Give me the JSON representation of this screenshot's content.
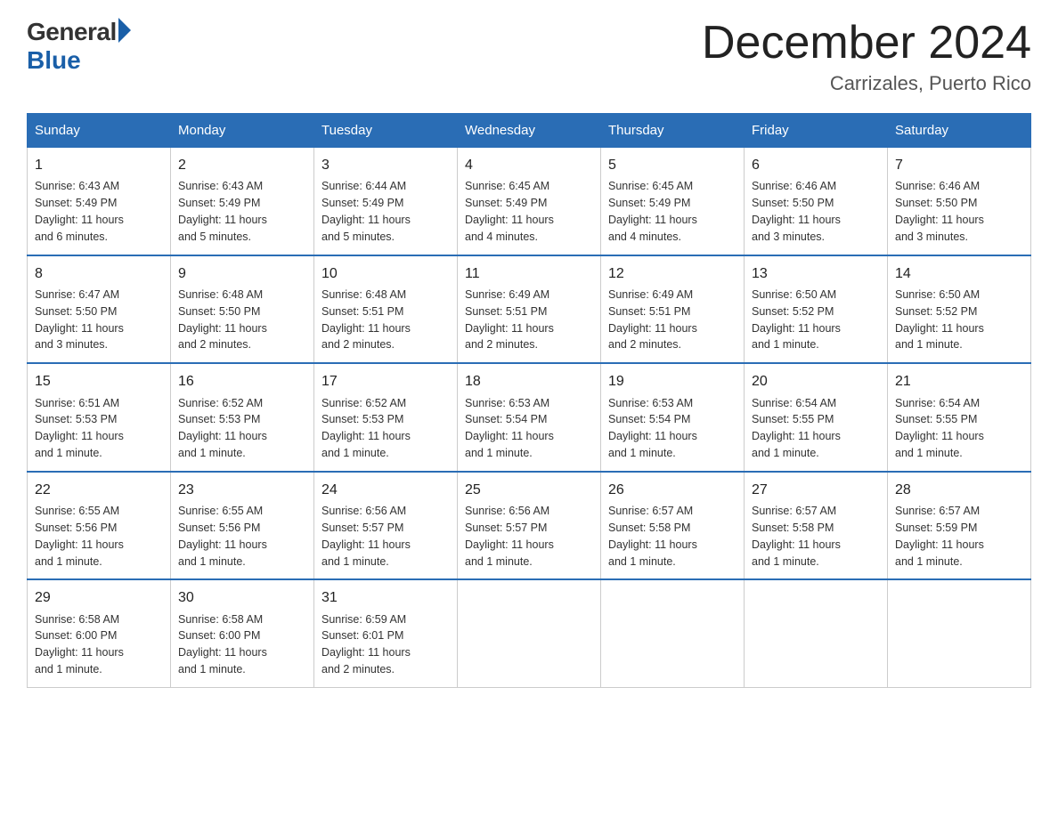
{
  "logo": {
    "general": "General",
    "blue": "Blue"
  },
  "title": "December 2024",
  "location": "Carrizales, Puerto Rico",
  "days_of_week": [
    "Sunday",
    "Monday",
    "Tuesday",
    "Wednesday",
    "Thursday",
    "Friday",
    "Saturday"
  ],
  "weeks": [
    [
      {
        "day": "1",
        "sunrise": "6:43 AM",
        "sunset": "5:49 PM",
        "daylight": "11 hours and 6 minutes."
      },
      {
        "day": "2",
        "sunrise": "6:43 AM",
        "sunset": "5:49 PM",
        "daylight": "11 hours and 5 minutes."
      },
      {
        "day": "3",
        "sunrise": "6:44 AM",
        "sunset": "5:49 PM",
        "daylight": "11 hours and 5 minutes."
      },
      {
        "day": "4",
        "sunrise": "6:45 AM",
        "sunset": "5:49 PM",
        "daylight": "11 hours and 4 minutes."
      },
      {
        "day": "5",
        "sunrise": "6:45 AM",
        "sunset": "5:49 PM",
        "daylight": "11 hours and 4 minutes."
      },
      {
        "day": "6",
        "sunrise": "6:46 AM",
        "sunset": "5:50 PM",
        "daylight": "11 hours and 3 minutes."
      },
      {
        "day": "7",
        "sunrise": "6:46 AM",
        "sunset": "5:50 PM",
        "daylight": "11 hours and 3 minutes."
      }
    ],
    [
      {
        "day": "8",
        "sunrise": "6:47 AM",
        "sunset": "5:50 PM",
        "daylight": "11 hours and 3 minutes."
      },
      {
        "day": "9",
        "sunrise": "6:48 AM",
        "sunset": "5:50 PM",
        "daylight": "11 hours and 2 minutes."
      },
      {
        "day": "10",
        "sunrise": "6:48 AM",
        "sunset": "5:51 PM",
        "daylight": "11 hours and 2 minutes."
      },
      {
        "day": "11",
        "sunrise": "6:49 AM",
        "sunset": "5:51 PM",
        "daylight": "11 hours and 2 minutes."
      },
      {
        "day": "12",
        "sunrise": "6:49 AM",
        "sunset": "5:51 PM",
        "daylight": "11 hours and 2 minutes."
      },
      {
        "day": "13",
        "sunrise": "6:50 AM",
        "sunset": "5:52 PM",
        "daylight": "11 hours and 1 minute."
      },
      {
        "day": "14",
        "sunrise": "6:50 AM",
        "sunset": "5:52 PM",
        "daylight": "11 hours and 1 minute."
      }
    ],
    [
      {
        "day": "15",
        "sunrise": "6:51 AM",
        "sunset": "5:53 PM",
        "daylight": "11 hours and 1 minute."
      },
      {
        "day": "16",
        "sunrise": "6:52 AM",
        "sunset": "5:53 PM",
        "daylight": "11 hours and 1 minute."
      },
      {
        "day": "17",
        "sunrise": "6:52 AM",
        "sunset": "5:53 PM",
        "daylight": "11 hours and 1 minute."
      },
      {
        "day": "18",
        "sunrise": "6:53 AM",
        "sunset": "5:54 PM",
        "daylight": "11 hours and 1 minute."
      },
      {
        "day": "19",
        "sunrise": "6:53 AM",
        "sunset": "5:54 PM",
        "daylight": "11 hours and 1 minute."
      },
      {
        "day": "20",
        "sunrise": "6:54 AM",
        "sunset": "5:55 PM",
        "daylight": "11 hours and 1 minute."
      },
      {
        "day": "21",
        "sunrise": "6:54 AM",
        "sunset": "5:55 PM",
        "daylight": "11 hours and 1 minute."
      }
    ],
    [
      {
        "day": "22",
        "sunrise": "6:55 AM",
        "sunset": "5:56 PM",
        "daylight": "11 hours and 1 minute."
      },
      {
        "day": "23",
        "sunrise": "6:55 AM",
        "sunset": "5:56 PM",
        "daylight": "11 hours and 1 minute."
      },
      {
        "day": "24",
        "sunrise": "6:56 AM",
        "sunset": "5:57 PM",
        "daylight": "11 hours and 1 minute."
      },
      {
        "day": "25",
        "sunrise": "6:56 AM",
        "sunset": "5:57 PM",
        "daylight": "11 hours and 1 minute."
      },
      {
        "day": "26",
        "sunrise": "6:57 AM",
        "sunset": "5:58 PM",
        "daylight": "11 hours and 1 minute."
      },
      {
        "day": "27",
        "sunrise": "6:57 AM",
        "sunset": "5:58 PM",
        "daylight": "11 hours and 1 minute."
      },
      {
        "day": "28",
        "sunrise": "6:57 AM",
        "sunset": "5:59 PM",
        "daylight": "11 hours and 1 minute."
      }
    ],
    [
      {
        "day": "29",
        "sunrise": "6:58 AM",
        "sunset": "6:00 PM",
        "daylight": "11 hours and 1 minute."
      },
      {
        "day": "30",
        "sunrise": "6:58 AM",
        "sunset": "6:00 PM",
        "daylight": "11 hours and 1 minute."
      },
      {
        "day": "31",
        "sunrise": "6:59 AM",
        "sunset": "6:01 PM",
        "daylight": "11 hours and 2 minutes."
      },
      null,
      null,
      null,
      null
    ]
  ],
  "labels": {
    "sunrise": "Sunrise:",
    "sunset": "Sunset:",
    "daylight": "Daylight:"
  }
}
